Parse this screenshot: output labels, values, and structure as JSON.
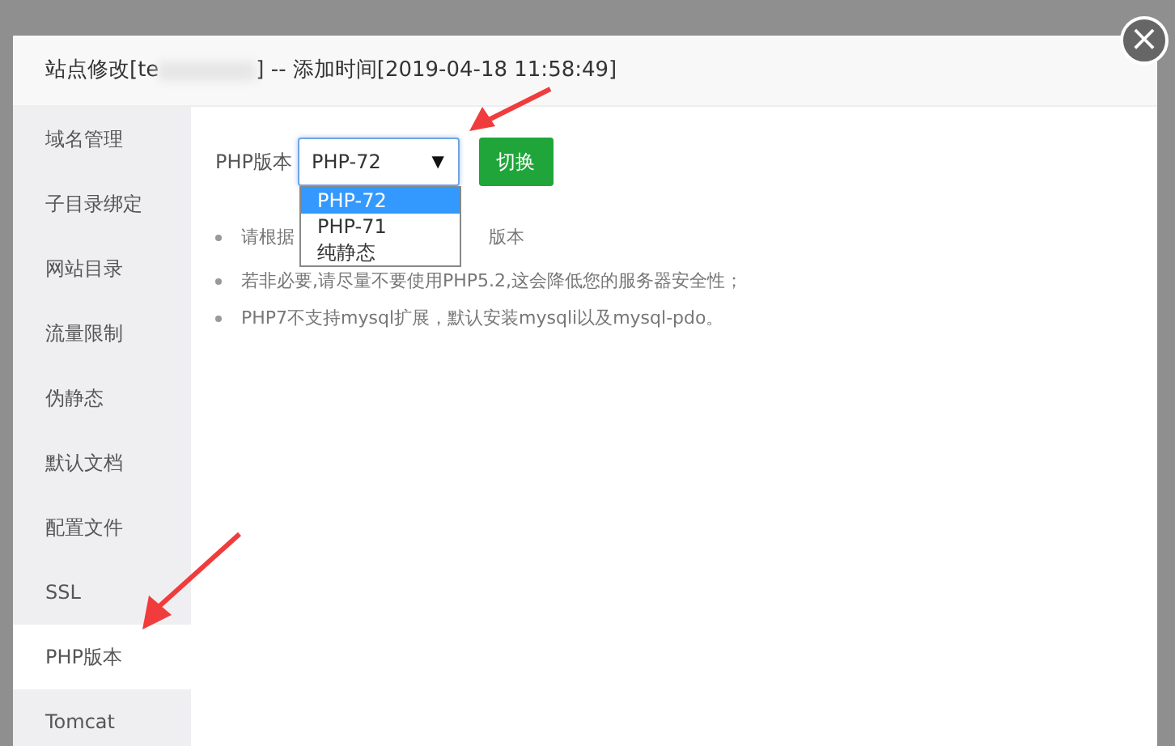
{
  "dialog": {
    "title_prefix": "站点修改[te",
    "title_suffix": "] -- 添加时间[2019-04-18 11:58:49]",
    "close": "×"
  },
  "sidebar": {
    "items": [
      {
        "label": "域名管理",
        "selected": false
      },
      {
        "label": "子目录绑定",
        "selected": false
      },
      {
        "label": "网站目录",
        "selected": false
      },
      {
        "label": "流量限制",
        "selected": false
      },
      {
        "label": "伪静态",
        "selected": false
      },
      {
        "label": "默认文档",
        "selected": false
      },
      {
        "label": "配置文件",
        "selected": false
      },
      {
        "label": "SSL",
        "selected": false
      },
      {
        "label": "PHP版本",
        "selected": true
      },
      {
        "label": "Tomcat",
        "selected": false
      }
    ]
  },
  "php_version": {
    "label": "PHP版本",
    "value": "PHP-72",
    "caret": "▼",
    "options": [
      {
        "label": "PHP-72",
        "selected": true
      },
      {
        "label": "PHP-71",
        "selected": false
      },
      {
        "label": "纯静态",
        "selected": false
      }
    ],
    "button": "切换"
  },
  "notes": [
    {
      "before": "请根据",
      "after": "版本"
    },
    {
      "text": "若非必要,请尽量不要使用PHP5.2,这会降低您的服务器安全性；"
    },
    {
      "text": "PHP7不支持mysql扩展，默认安装mysqli以及mysql-pdo。"
    }
  ]
}
